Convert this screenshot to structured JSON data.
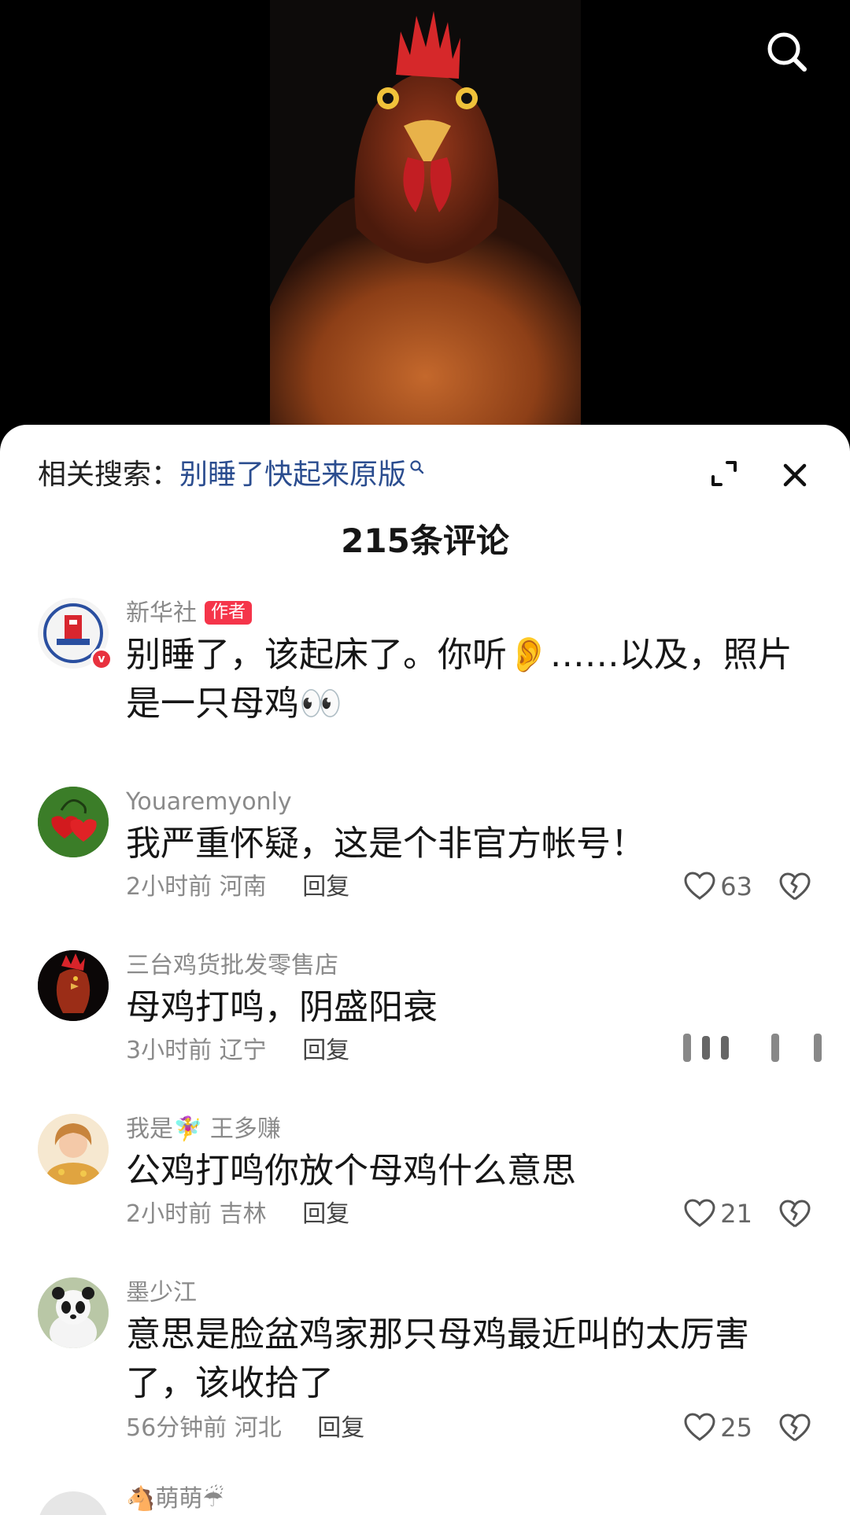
{
  "related_search": {
    "label": "相关搜索：",
    "keyword": "别睡了快起来原版"
  },
  "comment_count": "215条评论",
  "comments": [
    {
      "user": "新华社",
      "tag": "作者",
      "text": "别睡了，该起床了。你听👂……以及，照片是一只母鸡👀"
    },
    {
      "user": "Youaremyonly",
      "text": "我严重怀疑，这是个非官方帐号！",
      "time": "2小时前",
      "location": "河南",
      "reply": "回复",
      "likes": "63"
    },
    {
      "user": "三台鸡货批发零售店",
      "text": "母鸡打鸣，阴盛阳衰",
      "time": "3小时前",
      "location": "辽宁",
      "reply": "回复"
    },
    {
      "user": "我是🧚‍♀️ 王多赚",
      "text": "公鸡打鸣你放个母鸡什么意思",
      "time": "2小时前",
      "location": "吉林",
      "reply": "回复",
      "likes": "21"
    },
    {
      "user": "墨少江",
      "text": "意思是脸盆鸡家那只母鸡最近叫的太厉害了，该收拾了",
      "time": "56分钟前",
      "location": "河北",
      "reply": "回复",
      "likes": "25"
    },
    {
      "user": "🐴萌萌☔"
    }
  ],
  "icons": {
    "search": "search-icon",
    "expand": "expand-icon",
    "close": "close-icon",
    "like": "heart-outline-icon",
    "dislike": "broken-heart-icon"
  },
  "colors": {
    "keyword": "#2b4d8f",
    "author_tag": "#f5354a",
    "verified": "#e8313e"
  }
}
